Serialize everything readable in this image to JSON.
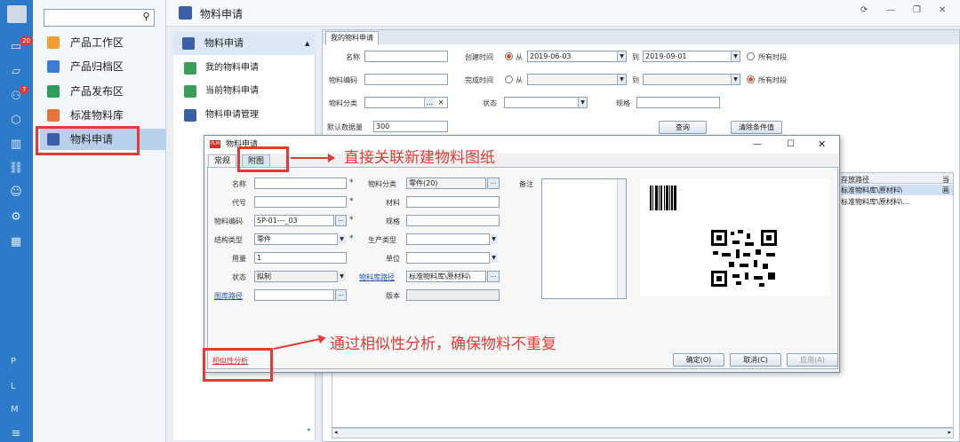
{
  "rail": {
    "badge1": "20",
    "badge2": "7",
    "letters": [
      "P",
      "L",
      "M"
    ]
  },
  "nav": {
    "search_placeholder": "",
    "items": [
      {
        "label": "产品工作区",
        "color": "#f0a030"
      },
      {
        "label": "产品归档区",
        "color": "#3a7bd5"
      },
      {
        "label": "产品发布区",
        "color": "#2e9e5b"
      },
      {
        "label": "标准物料库",
        "color": "#e8743b"
      },
      {
        "label": "物料申请",
        "color": "#3b5fa8"
      }
    ]
  },
  "header": {
    "title": "物料申请"
  },
  "subnav": {
    "head": "物料申请",
    "items": [
      {
        "label": "我的物料申请",
        "color": "#3a9e5b"
      },
      {
        "label": "当前物料申请",
        "color": "#3a9e5b"
      },
      {
        "label": "物料申请管理",
        "color": "#3b5fa8"
      }
    ]
  },
  "main": {
    "tab": "我的物料申请",
    "labels": {
      "name": "名称",
      "code": "物料编码",
      "category": "物料分类",
      "default_count": "默认数据量",
      "created": "创建时间",
      "from": "从",
      "to": "到",
      "all_time": "所有时段",
      "completed": "完成时间",
      "status": "状态",
      "spec": "规格"
    },
    "values": {
      "created_from": "2019-06-03",
      "created_to": "2019-09-01",
      "default_count": "300",
      "ellipsis": "...",
      "clear_x": "✕"
    },
    "buttons": {
      "query": "查询",
      "clear": "清除条件值"
    },
    "grid": {
      "header": "存放路径",
      "header2": "当",
      "rows": [
        "标准物料库\\原材料\\",
        "标准物料库\\原材料\\..."
      ],
      "row_extra": "画"
    }
  },
  "dialog": {
    "title": "物料申请",
    "logo": "PLM",
    "tabs": [
      "常规",
      "附图"
    ],
    "labels": {
      "name": "名称",
      "code_alias": "代号",
      "mat_code": "物料编码",
      "struct_type": "结构类型",
      "usage": "用量",
      "status": "状态",
      "drawing_path": "图库路径",
      "category": "物料分类",
      "material": "材料",
      "spec": "规格",
      "prod_type": "生产类型",
      "unit": "单位",
      "lib_path": "物料库路径",
      "version": "版本",
      "notes": "备注",
      "similarity": "相似性分析"
    },
    "values": {
      "name": "",
      "category": "零件(20)",
      "mat_code": "SP-01---_03",
      "struct_type": "零件",
      "usage": "1",
      "status": "拟制",
      "lib_path": "标准物料库\\原材料\\",
      "ellipsis": "...",
      "star": "*"
    },
    "buttons": {
      "ok": "确定(O)",
      "cancel": "取消(C)",
      "apply": "应用(A)"
    }
  },
  "annotations": {
    "top": "直接关联新建物料图纸",
    "bottom": "通过相似性分析，确保物料不重复"
  }
}
